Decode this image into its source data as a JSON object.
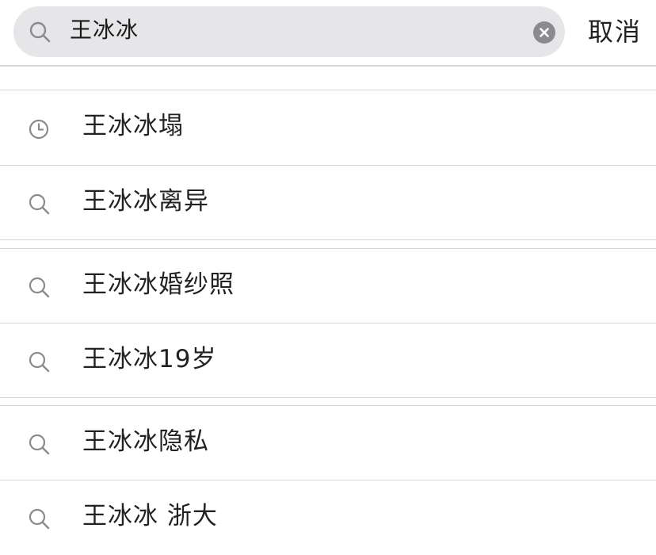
{
  "search": {
    "query": "王冰冰",
    "cancel_label": "取消"
  },
  "suggestions": [
    {
      "icon": "clock-icon",
      "label": "王冰冰塌"
    },
    {
      "icon": "search-icon",
      "label": "王冰冰离异"
    },
    {
      "icon": "search-icon",
      "label": "王冰冰婚纱照"
    },
    {
      "icon": "search-icon",
      "label": "王冰冰19岁"
    },
    {
      "icon": "search-icon",
      "label": "王冰冰隐私"
    },
    {
      "icon": "search-icon",
      "label": "王冰冰 浙大"
    }
  ],
  "colors": {
    "search_box_bg": "#e6e6e9",
    "icon_gray": "#8a8a8f",
    "divider": "#d6d6d6"
  }
}
